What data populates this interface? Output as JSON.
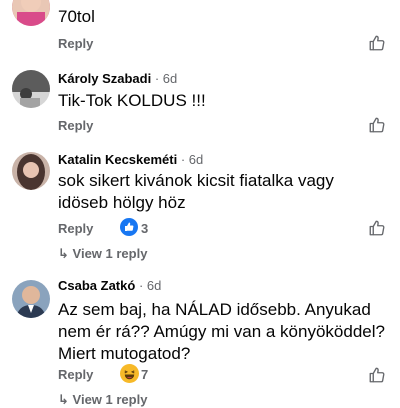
{
  "comments": [
    {
      "author": "",
      "time": "",
      "text": "70tol",
      "reply": "Reply",
      "avatar_color": "#d94b8a",
      "reaction_count": "",
      "view_replies": ""
    },
    {
      "author": "Károly Szabadi",
      "time": "· 6d",
      "text": "Tik-Tok KOLDUS !!!",
      "reply": "Reply",
      "avatar_color": "#6b6b6b",
      "reaction_count": "",
      "view_replies": ""
    },
    {
      "author": "Katalin Kecskeméti",
      "time": "· 6d",
      "text": "sok sikert kivánok kicsit fiatalka vagy idöseb hölgy höz",
      "reply": "Reply",
      "avatar_color": "#8a6d62",
      "reaction_icon": "like-reaction-icon",
      "reaction_count": "3",
      "view_replies": "View 1 reply"
    },
    {
      "author": "Csaba Zatkó",
      "time": "· 6d",
      "text": "Az sem baj, ha NÁLAD idősebb. Anyukad nem ér rá?? Amúgy mi van a könyököddel? Miert mutogatod?",
      "reply": "Reply",
      "avatar_color": "#3a4f6b",
      "reaction_icon": "haha-reaction-icon",
      "reaction_count": "7",
      "view_replies": "View 1 reply"
    }
  ],
  "colors": {
    "secondary_text": "#65676b",
    "like_blue": "#1877f2",
    "haha_yellow": "#f7b928"
  }
}
